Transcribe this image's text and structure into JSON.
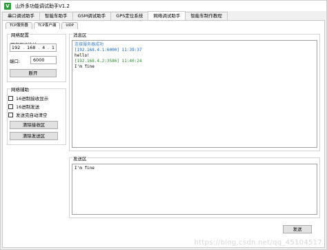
{
  "window": {
    "icon_letter": "V",
    "title": "山外多功能调试助手V1.2"
  },
  "main_tabs": [
    "串口调试助手",
    "智能车助手",
    "GSM调试助手",
    "GPS定位系统",
    "网络调试助手",
    "智能车制作教程"
  ],
  "sub_tabs": [
    "TCP服务器",
    "TCP客户端",
    "UDP"
  ],
  "network_config": {
    "title": "网络配置",
    "server_ip_label": "服务器IP地址:",
    "ip_parts": [
      "192",
      "168",
      "4",
      "1"
    ],
    "port_label": "端口:",
    "port_value": "6000",
    "open_button": "断开"
  },
  "network_assist": {
    "title": "网络辅助",
    "checkboxes": [
      "16进制接收显示",
      "16进制发送",
      "发送完自动清空"
    ],
    "clear_receive_button": "清除接收区",
    "clear_send_button": "清除发送区"
  },
  "message_area": {
    "title": "消息区",
    "lines": [
      "连接服务器成功",
      "[192.168.4.1:6000] 11:39:37",
      "hello!",
      "[192.168.4.2:3586] 11:40:24",
      "I'm fine"
    ]
  },
  "send_area": {
    "title": "发送区",
    "content": "I'm fine",
    "send_button": "发送"
  },
  "watermark": "https://blog.csdn.net/qq_45104517"
}
